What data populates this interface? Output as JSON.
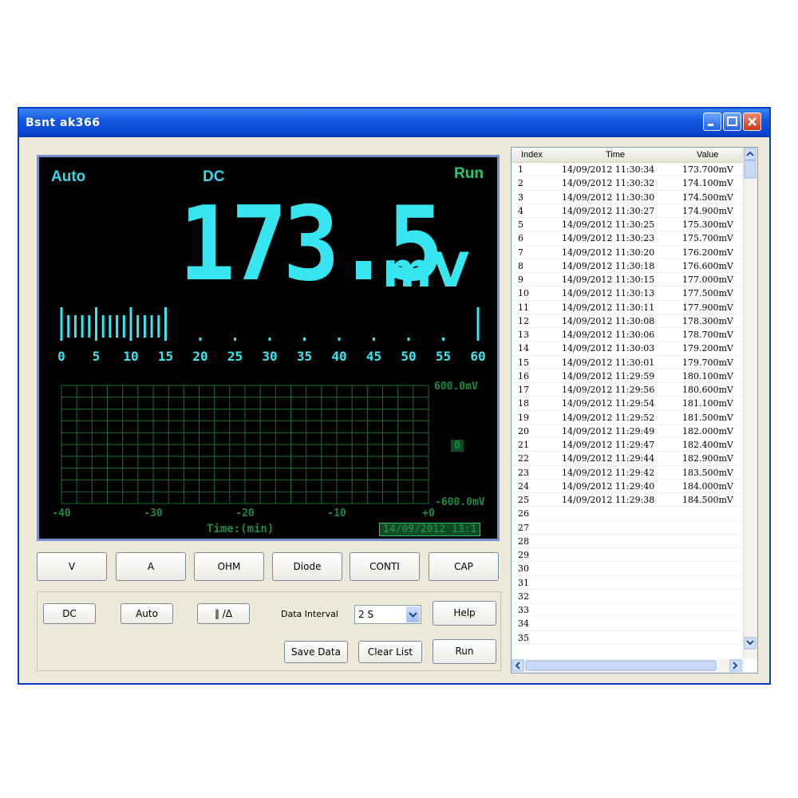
{
  "window": {
    "title": "Bsnt ak366"
  },
  "display": {
    "range_mode": "Auto",
    "coupling": "DC",
    "run_state": "Run",
    "reading": "173.5",
    "unit": "mV",
    "bargraph": {
      "ticks": [
        "0",
        "5",
        "10",
        "15",
        "20",
        "25",
        "30",
        "35",
        "40",
        "45",
        "50",
        "55",
        "60"
      ],
      "lit_fraction": 0.26
    },
    "trend": {
      "y_top": "600.0mV",
      "y_mid": "0",
      "y_bottom": "-600.0mV",
      "x_ticks": [
        "-40",
        "-30",
        "-20",
        "-10",
        "+0"
      ],
      "x_label": "Time:(min)",
      "timestamp": "14/09/2012 13:1"
    }
  },
  "mode_buttons": [
    "V",
    "A",
    "OHM",
    "Diode",
    "CONTI",
    "CAP"
  ],
  "controls": {
    "dc_label": "DC",
    "auto_label": "Auto",
    "hold_label": "‖ /Δ",
    "interval_label": "Data Interval",
    "interval_value": "2 S",
    "help_label": "Help",
    "save_label": "Save Data",
    "clear_label": "Clear List",
    "run_label": "Run"
  },
  "list": {
    "columns": [
      "Index",
      "Time",
      "Value"
    ],
    "rows": [
      [
        "1",
        "14/09/2012  11:30:34",
        "173.700mV"
      ],
      [
        "2",
        "14/09/2012  11:30:32",
        "174.100mV"
      ],
      [
        "3",
        "14/09/2012  11:30:30",
        "174.500mV"
      ],
      [
        "4",
        "14/09/2012  11:30:27",
        "174.900mV"
      ],
      [
        "5",
        "14/09/2012  11:30:25",
        "175.300mV"
      ],
      [
        "6",
        "14/09/2012  11:30:23",
        "175.700mV"
      ],
      [
        "7",
        "14/09/2012  11:30:20",
        "176.200mV"
      ],
      [
        "8",
        "14/09/2012  11:30:18",
        "176.600mV"
      ],
      [
        "9",
        "14/09/2012  11:30:15",
        "177.000mV"
      ],
      [
        "10",
        "14/09/2012  11:30:13",
        "177.500mV"
      ],
      [
        "11",
        "14/09/2012  11:30:11",
        "177.900mV"
      ],
      [
        "12",
        "14/09/2012  11:30:08",
        "178.300mV"
      ],
      [
        "13",
        "14/09/2012  11:30:06",
        "178.700mV"
      ],
      [
        "14",
        "14/09/2012  11:30:03",
        "179.200mV"
      ],
      [
        "15",
        "14/09/2012  11:30:01",
        "179.700mV"
      ],
      [
        "16",
        "14/09/2012  11:29:59",
        "180.100mV"
      ],
      [
        "17",
        "14/09/2012  11:29:56",
        "180.600mV"
      ],
      [
        "18",
        "14/09/2012  11:29:54",
        "181.100mV"
      ],
      [
        "19",
        "14/09/2012  11:29:52",
        "181.500mV"
      ],
      [
        "20",
        "14/09/2012  11:29:49",
        "182.000mV"
      ],
      [
        "21",
        "14/09/2012  11:29:47",
        "182.400mV"
      ],
      [
        "22",
        "14/09/2012  11:29:44",
        "182.900mV"
      ],
      [
        "23",
        "14/09/2012  11:29:42",
        "183.500mV"
      ],
      [
        "24",
        "14/09/2012  11:29:40",
        "184.000mV"
      ],
      [
        "25",
        "14/09/2012  11:29:38",
        "184.500mV"
      ],
      [
        "26",
        "",
        ""
      ],
      [
        "27",
        "",
        ""
      ],
      [
        "28",
        "",
        ""
      ],
      [
        "29",
        "",
        ""
      ],
      [
        "30",
        "",
        ""
      ],
      [
        "31",
        "",
        ""
      ],
      [
        "32",
        "",
        ""
      ],
      [
        "33",
        "",
        ""
      ],
      [
        "34",
        "",
        ""
      ],
      [
        "35",
        "",
        ""
      ]
    ]
  }
}
